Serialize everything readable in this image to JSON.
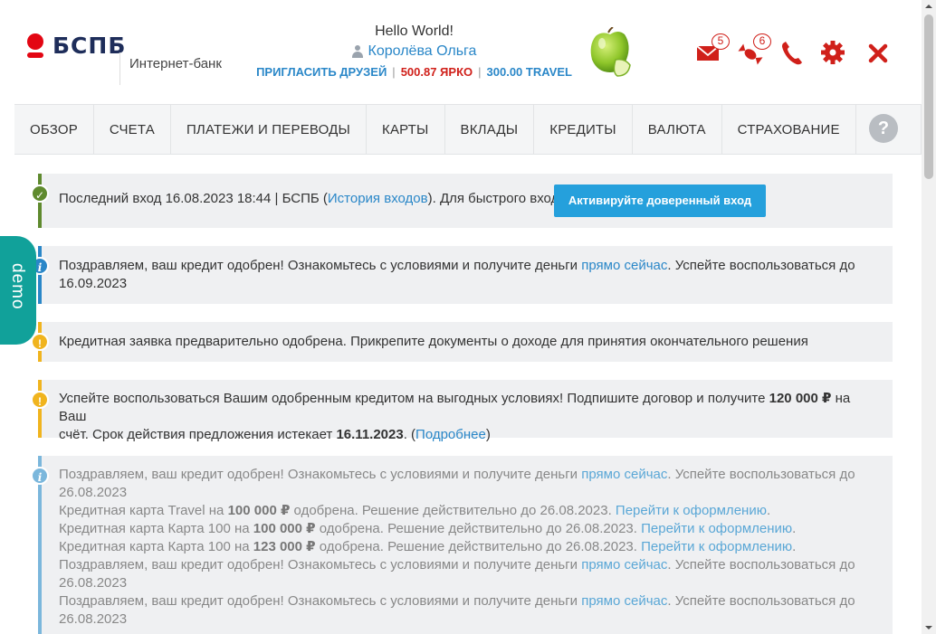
{
  "header": {
    "logo_text": "БСПБ",
    "logo_sub": "Интернет-банк",
    "greeting": "Hello World!",
    "user_name": "Королёва Ольга",
    "invite_label": "ПРИГЛАСИТЬ ДРУЗЕЙ",
    "yarko_balance": "500.87 ЯРКО",
    "travel_balance": "300.00 TRAVEL",
    "separator": "|",
    "mail_count": "5",
    "gift_count": "6",
    "icons": [
      "mail-icon",
      "gift-icon",
      "phone-icon",
      "settings-icon",
      "close-icon"
    ]
  },
  "nav": {
    "items": [
      "ОБЗОР",
      "СЧЕТА",
      "ПЛАТЕЖИ И ПЕРЕВОДЫ",
      "КАРТЫ",
      "ВКЛАДЫ",
      "КРЕДИТЫ",
      "ВАЛЮТА",
      "СТРАХОВАНИЕ"
    ],
    "help": "?"
  },
  "alerts": {
    "login": {
      "text_before": "Последний вход 16.08.2023 18:44 | БСПБ (",
      "history_link": "История входов",
      "text_after": "). Для быстрого входа",
      "button": "Активируйте доверенный вход"
    },
    "credit_approved": {
      "text_before": "Поздравляем, ваш кредит одобрен! Ознакомьтесь с условиями и получите деньги ",
      "link": "прямо сейчас",
      "text_after": ". Успейте воспользоваться до",
      "date": "16.09.2023"
    },
    "preapproved": {
      "text": "Кредитная заявка предварительно одобрена. Прикрепите документы о доходе для принятия окончательного решения"
    },
    "offer": {
      "text1": "Успейте воспользоваться Вашим одобренным кредитом на выгодных условиях! Подпишите договор и получите ",
      "amount": "120 000 ₽",
      "text2": " на Ваш",
      "text3": "счёт. Срок действия предложения истекает ",
      "date": "16.11.2023",
      "text4": ". (",
      "link": "Подробнее",
      "text5": ")"
    },
    "multi": {
      "congrats_before": "Поздравляем, ваш кредит одобрен! Ознакомьтесь с условиями и получите деньги ",
      "congrats_link": "прямо сейчас",
      "congrats_after": ". Успейте воспользоваться до",
      "congrats_date": "26.08.2023",
      "card1_before": "Кредитная карта Travel на ",
      "card1_amount": "100 000 ₽",
      "card2_before": "Кредитная карта Карта 100 на ",
      "card2_amount": "100 000 ₽",
      "card3_before": "Кредитная карта Карта 100 на ",
      "card3_amount": "123 000 ₽",
      "card_after": " одобрена. Решение действительно до 26.08.2023. ",
      "card_link": "Перейти к оформлению",
      "period": "."
    }
  },
  "demo_label": "demo",
  "colors": {
    "brand_red": "#e30613",
    "brand_navy": "#1e2d5a",
    "link_blue": "#2a87c8",
    "button_blue": "#25a0dc",
    "alert_green": "#5f8a2e",
    "alert_yellow": "#f0b41e",
    "demo_teal": "#11a19a"
  }
}
